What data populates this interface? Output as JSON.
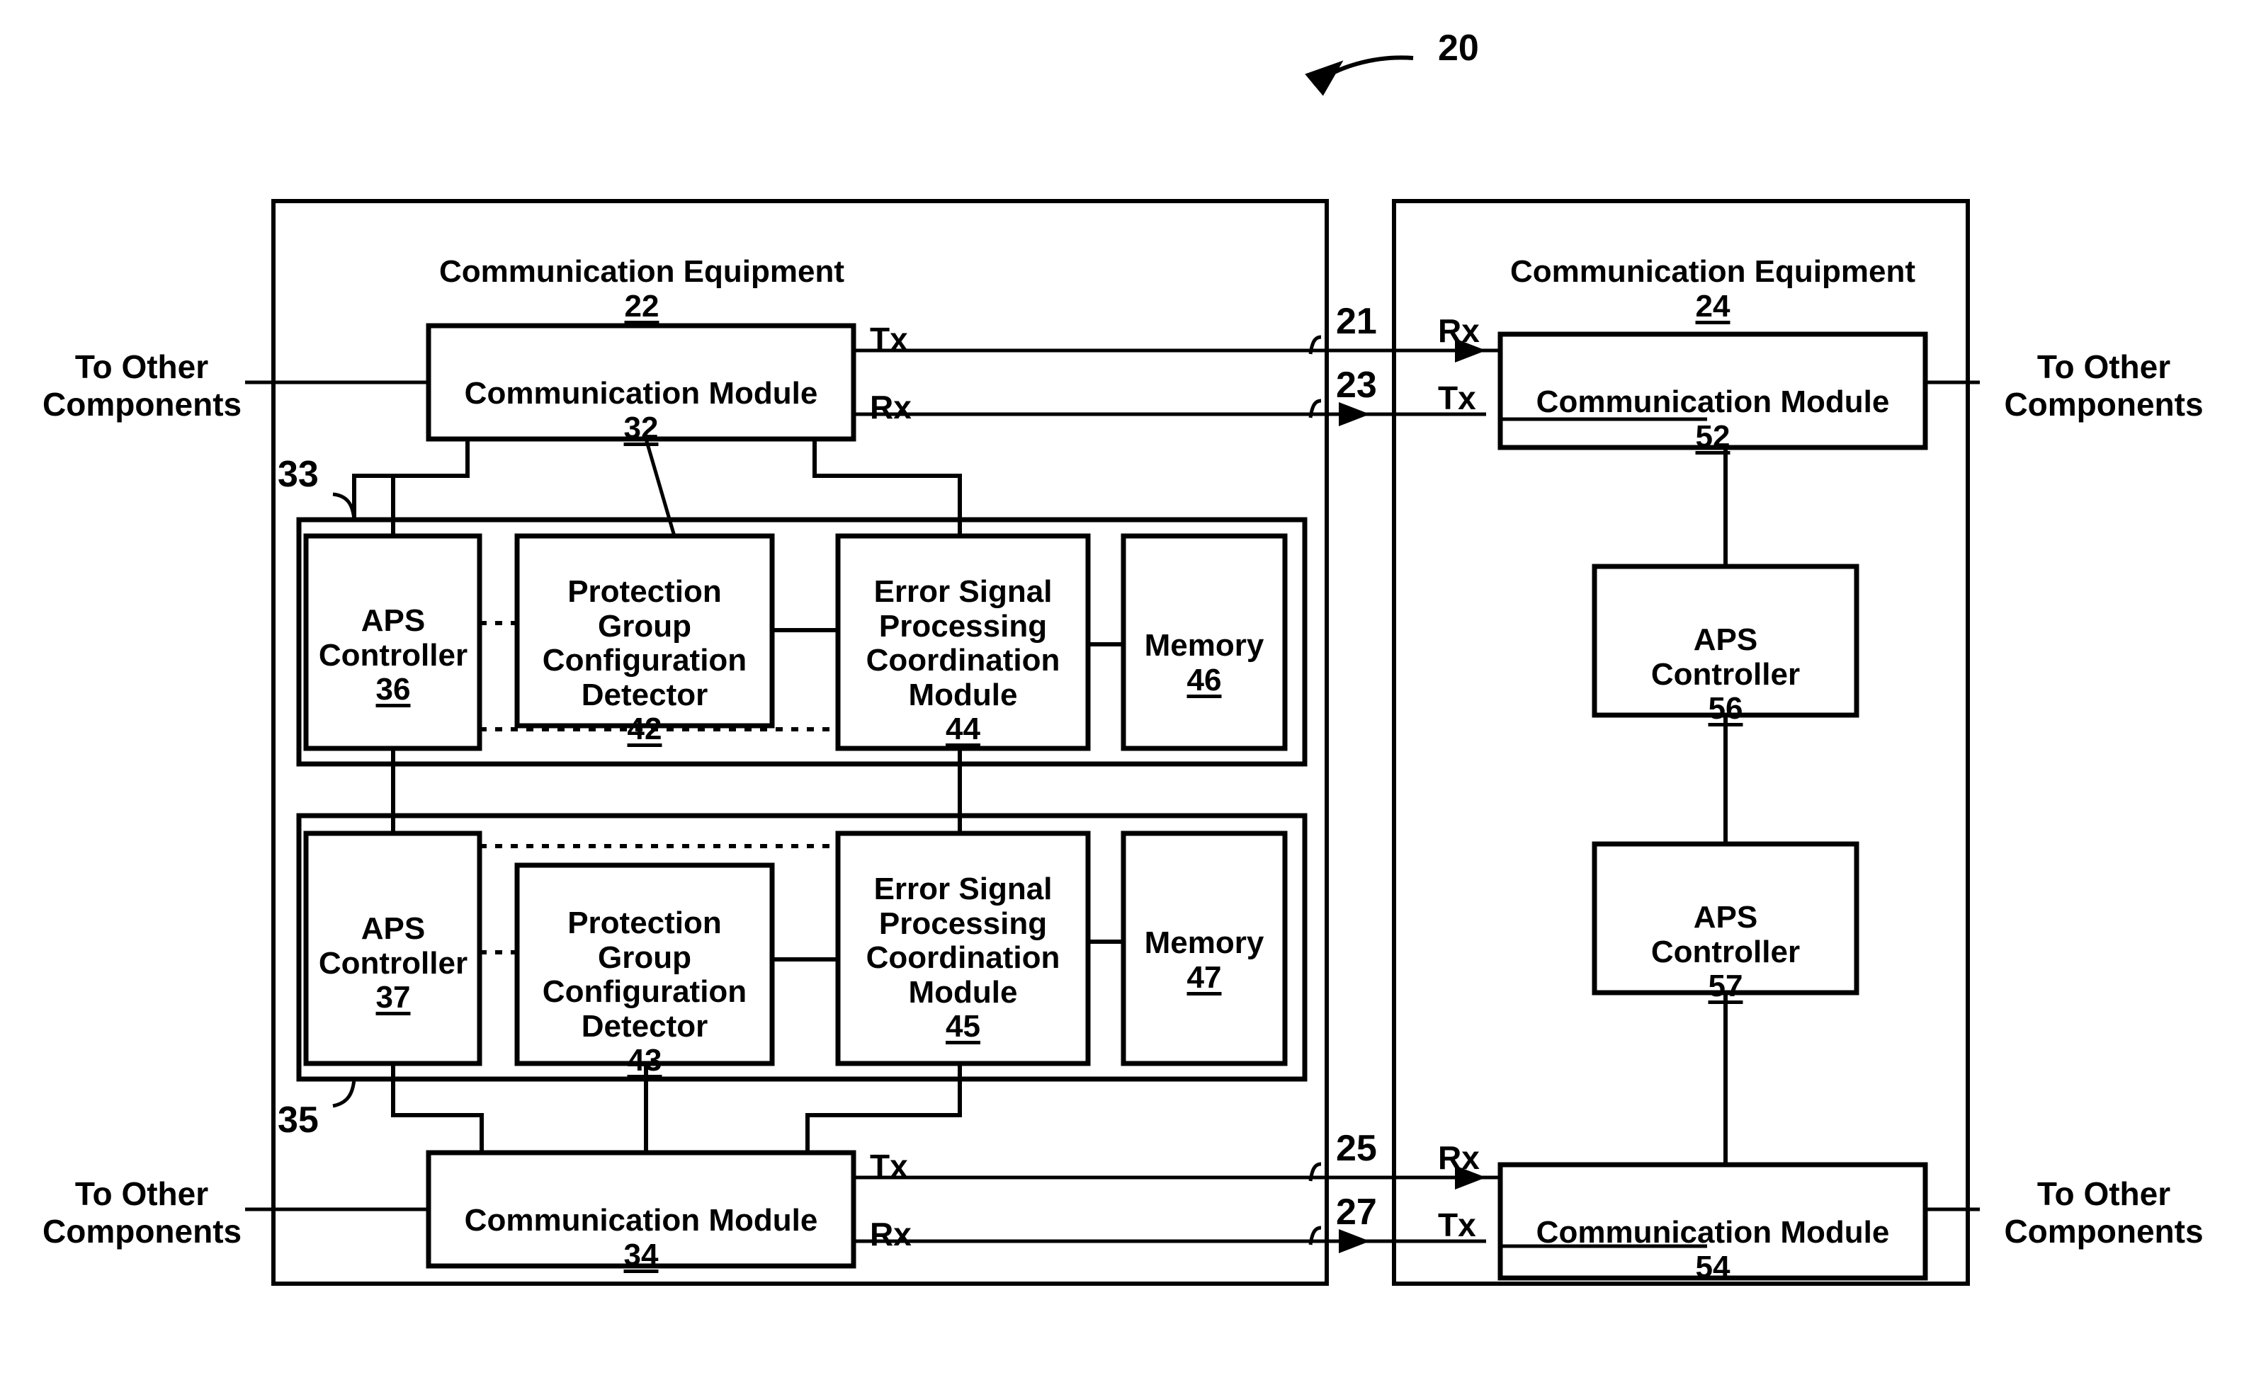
{
  "figure": {
    "ref": "20"
  },
  "equipment_left": {
    "title": "Communication Equipment",
    "ref": "22",
    "comm_module_top": {
      "title": "Communication Module",
      "ref": "32"
    },
    "comm_module_bottom": {
      "title": "Communication Module",
      "ref": "34"
    },
    "group_top_ref": "33",
    "group_bottom_ref": "35",
    "group_top": {
      "aps": {
        "title": "APS\nController",
        "ref": "36"
      },
      "detector": {
        "title": "Protection Group\nConfiguration\nDetector",
        "ref": "42"
      },
      "error": {
        "title": "Error Signal\nProcessing\nCoordination\nModule",
        "ref": "44"
      },
      "memory": {
        "title": "Memory",
        "ref": "46"
      }
    },
    "group_bottom": {
      "aps": {
        "title": "APS\nController",
        "ref": "37"
      },
      "detector": {
        "title": "Protection Group\nConfiguration\nDetector",
        "ref": "43"
      },
      "error": {
        "title": "Error Signal\nProcessing\nCoordination\nModule",
        "ref": "45"
      },
      "memory": {
        "title": "Memory",
        "ref": "47"
      }
    },
    "ports": {
      "tx_top": "Tx",
      "rx_top": "Rx",
      "tx_bottom": "Tx",
      "rx_bottom": "Rx"
    },
    "external_top": "To Other\nComponents",
    "external_bottom": "To Other\nComponents"
  },
  "equipment_right": {
    "title": "Communication Equipment",
    "ref": "24",
    "comm_module_top": {
      "title": "Communication Module",
      "ref": "52"
    },
    "comm_module_bottom": {
      "title": "Communication Module",
      "ref": "54"
    },
    "aps_top": {
      "title": "APS\nController",
      "ref": "56"
    },
    "aps_bottom": {
      "title": "APS\nController",
      "ref": "57"
    },
    "ports": {
      "rx_top": "Rx",
      "tx_top": "Tx",
      "rx_bottom": "Rx",
      "tx_bottom": "Tx"
    },
    "external_top": "To Other\nComponents",
    "external_bottom": "To Other\nComponents"
  },
  "links": {
    "top_forward": "21",
    "top_reverse": "23",
    "bottom_forward": "25",
    "bottom_reverse": "27"
  }
}
